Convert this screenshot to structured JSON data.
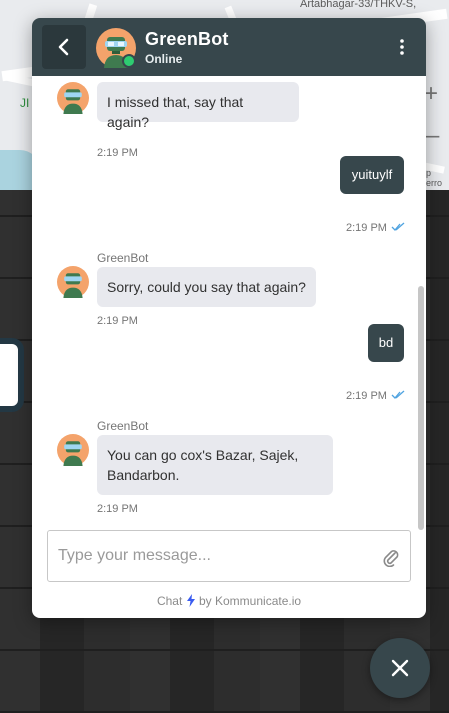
{
  "background": {
    "map_label_top": "Artabhagar-33/THKV-S,",
    "map_label_left": "JI",
    "map_label_right": "p erro"
  },
  "header": {
    "bot_name": "GreenBot",
    "status": "Online"
  },
  "messages": [
    {
      "direction": "in",
      "sender": "",
      "text": "I missed that, say that again?",
      "time": "2:19 PM"
    },
    {
      "direction": "out",
      "text": "yuituylf",
      "time": "2:19 PM",
      "read": true
    },
    {
      "direction": "in",
      "sender": "GreenBot",
      "text": "Sorry, could you say that again?",
      "time": "2:19 PM"
    },
    {
      "direction": "out",
      "text": "bd",
      "time": "2:19 PM",
      "read": true
    },
    {
      "direction": "in",
      "sender": "GreenBot",
      "text": "You can go cox's Bazar, Sajek, Bandarbon.",
      "time": "2:19 PM"
    }
  ],
  "composer": {
    "placeholder": "Type your message...",
    "value": ""
  },
  "footer": {
    "prefix": "Chat",
    "suffix": "by Kommunicate.io"
  },
  "colors": {
    "header_bg": "#37474c",
    "outgoing_bubble": "#37474c",
    "incoming_bubble": "#e8e9ee",
    "online": "#2ecc71",
    "read_tick": "#4fa3e0",
    "bolt": "#3a5cf0"
  },
  "icons": {
    "back": "chevron-left-icon",
    "menu": "kebab-menu-icon",
    "attach": "paperclip-icon",
    "close": "close-icon",
    "read": "double-check-icon",
    "brand": "lightning-bolt-icon"
  }
}
